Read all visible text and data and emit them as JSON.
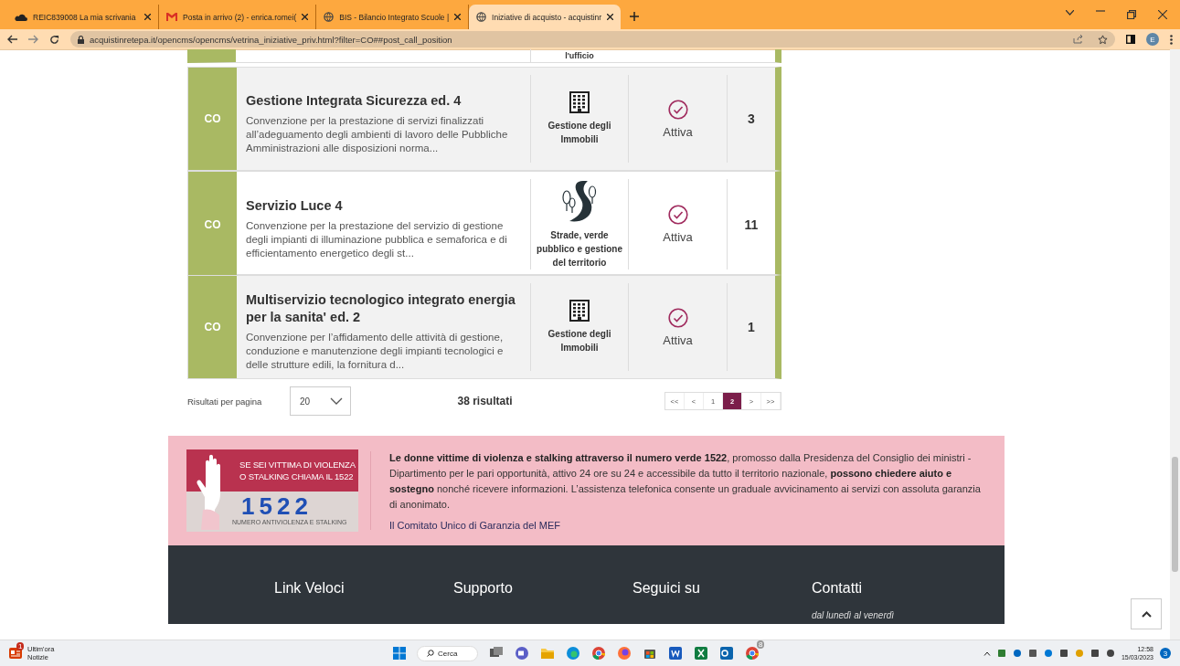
{
  "browser": {
    "tabs": [
      {
        "title": "REIC839008 La mia scrivania",
        "selected": false
      },
      {
        "title": "Posta in arrivo (2) - enrica.romei(",
        "selected": false
      },
      {
        "title": "BIS - Bilancio Integrato Scuole |",
        "selected": false
      },
      {
        "title": "Iniziative di acquisto - acquistinr",
        "selected": true
      }
    ],
    "url": "acquistinretepa.it/opencms/opencms/vetrina_iniziative_priv.html?filter=CO##post_call_position",
    "profile_initial": "E"
  },
  "partial_card": {
    "category": "l'ufficio"
  },
  "initiatives": [
    {
      "badge": "CO",
      "title": "Gestione Integrata Sicurezza ed. 4",
      "description": "Convenzione per la prestazione di servizi finalizzati all’adeguamento degli ambienti di lavoro delle Pubbliche Amministrazioni alle disposizioni norma...",
      "kind": "building",
      "category": "Gestione degli Immobili",
      "status": "Attiva",
      "count": "3"
    },
    {
      "badge": "CO",
      "title": "Servizio Luce 4",
      "description": "Convenzione per la prestazione del servizio di gestione degli impianti di illuminazione pubblica e semaforica e di efficientamento energetico degli st...",
      "kind": "road",
      "category": "Strade, verde pubblico e gestione del territorio",
      "status": "Attiva",
      "count": "11"
    },
    {
      "badge": "CO",
      "title": "Multiservizio tecnologico integrato energia per la sanita' ed. 2",
      "description": "Convenzione per l’affidamento delle attività di gestione, conduzione e manutenzione degli impianti tecnologici e delle strutture edili, la fornitura d...",
      "kind": "building",
      "category": "Gestione degli Immobili",
      "status": "Attiva",
      "count": "1"
    }
  ],
  "results": {
    "per_page_label": "Risultati per pagina",
    "per_page": "20",
    "total": "38 risultati",
    "pages": [
      {
        "label": "<<",
        "selected": false
      },
      {
        "label": "<",
        "selected": false
      },
      {
        "label": "1",
        "selected": false
      },
      {
        "label": "2",
        "selected": true
      },
      {
        "label": ">",
        "selected": false
      },
      {
        "label": ">>",
        "selected": false
      }
    ]
  },
  "banner": {
    "image_line1": "SE SEI VITTIMA DI VIOLENZA",
    "image_line2": "O STALKING CHIAMA IL 1522",
    "image_number": "1522",
    "image_caption": "NUMERO ANTIVIOLENZA E STALKING",
    "text": "**Le donne vittime di violenza e stalking attraverso il numero verde 1522**, promosso dalla Presidenza del Consiglio dei ministri - Dipartimento per le pari opportunità, attivo 24 ore su 24 e accessibile da tutto il territorio nazionale, **possono chiedere aiuto e sostegno** nonché ricevere informazioni. L’assistenza telefonica consente un graduale avvicinamento ai servizi con assoluta garanzia di anonimato.",
    "link": "Il Comitato Unico di Garanzia del MEF"
  },
  "footer": {
    "columns": [
      "Link Veloci",
      "Supporto",
      "Seguici su",
      "Contatti"
    ],
    "contact_hours": "dal lunedì al venerdì"
  },
  "taskbar": {
    "news_badge": "1",
    "news_title": "Ultim'ora",
    "news_subtitle": "Notizie",
    "search": "Cerca",
    "app_badge": "8",
    "time": "12:58",
    "date": "15/03/2023",
    "notification_count": "3"
  }
}
